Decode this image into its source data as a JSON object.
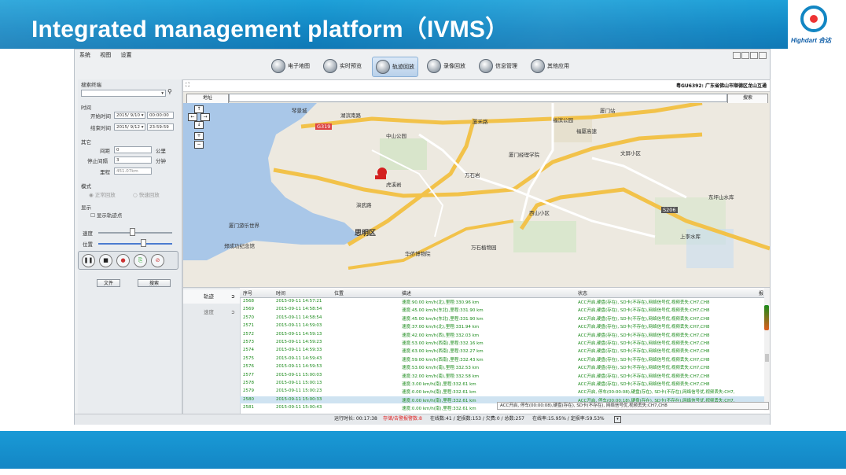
{
  "slide": {
    "title": "Integrated management platform（IVMS）",
    "logo_text": "Highdart 合达"
  },
  "menu": [
    "系统",
    "视图",
    "设置"
  ],
  "toolbar": [
    {
      "label": "电子地图",
      "icon": "map-icon"
    },
    {
      "label": "实时预览",
      "icon": "camera-icon"
    },
    {
      "label": "轨迹回放",
      "icon": "track-icon",
      "active": true
    },
    {
      "label": "录像回放",
      "icon": "video-icon"
    },
    {
      "label": "信息管理",
      "icon": "info-icon"
    },
    {
      "label": "其他应用",
      "icon": "apps-icon"
    }
  ],
  "left": {
    "search_label": "搜索终端",
    "time_label": "时间",
    "start_label": "开始时间",
    "start_date": "2015/ 9/10 ▾",
    "start_time": "00:00:00",
    "end_label": "结束时间",
    "end_date": "2015/ 9/12 ▾",
    "end_time": "23:59:59",
    "other_label": "其它",
    "range_label": "间距",
    "range_value": "0",
    "range_unit": "公里",
    "stop_label": "停止间隔",
    "stop_value": "3",
    "stop_unit": "分钟",
    "mileage_label": "里程",
    "mileage_value": "451.07km",
    "mode_label": "模式",
    "mode_normal": "正常回放",
    "mode_fast": "快速回放",
    "display_label": "显示",
    "show_points": "显示轨迹点",
    "speed_label": "速度",
    "position_label": "位置",
    "file_btn": "文件",
    "search_btn": "搜索"
  },
  "map": {
    "addr_label": "地址",
    "search_btn": "搜索",
    "vehicle_info": "粤GU6392: 广东省佛山市顺德区龙山互通",
    "labels": [
      "琴景城",
      "湖滨南路",
      "厦门站",
      "福滨公园",
      "厦禾路",
      "中山公园",
      "文屏小区",
      "厦门经理学院",
      "万石岩",
      "东坪山水库",
      "思明区",
      "上李水库",
      "厦门游乐世界",
      "郑成功纪念馆",
      "华侨博物院",
      "万石植物园",
      "西山小区",
      "G319",
      "S206",
      "福厦高速",
      "演武路",
      "虎溪岩"
    ]
  },
  "tabs": [
    "轨迹",
    "速度"
  ],
  "table": {
    "headers": [
      "序号",
      "时间",
      "位置",
      "描述",
      "状态",
      "报"
    ],
    "rows": [
      {
        "id": "2568",
        "time": "2015-09-11 14:57:21",
        "desc": "速度:90.00 km/h(北),里程:330.96 km",
        "status": "ACC开启,硬盘(存在), SD卡(不存在),网络信号优,视频丢失:CH7,CH8"
      },
      {
        "id": "2569",
        "time": "2015-09-11 14:58:54",
        "desc": "速度:45.00 km/h(东北),里程:331.90 km",
        "status": "ACC开启,硬盘(存在), SD卡(不存在),网络信号优,视频丢失:CH7,CH8"
      },
      {
        "id": "2570",
        "time": "2015-09-11 14:58:54",
        "desc": "速度:45.00 km/h(东北),里程:331.90 km",
        "status": "ACC开启,硬盘(存在), SD卡(不存在),网络信号优,视频丢失:CH7,CH8"
      },
      {
        "id": "2571",
        "time": "2015-09-11 14:59:03",
        "desc": "速度:37.00 km/h(北),里程:331.94 km",
        "status": "ACC开启,硬盘(存在), SD卡(不存在),网络信号优,视频丢失:CH7,CH8"
      },
      {
        "id": "2572",
        "time": "2015-09-11 14:59:13",
        "desc": "速度:42.00 km/h(西),里程:332.03 km",
        "status": "ACC开启,硬盘(存在), SD卡(不存在),网络信号优,视频丢失:CH7,CH8"
      },
      {
        "id": "2573",
        "time": "2015-09-11 14:59:23",
        "desc": "速度:53.00 km/h(西南),里程:332.16 km",
        "status": "ACC开启,硬盘(存在), SD卡(不存在),网络信号优,视频丢失:CH7,CH8"
      },
      {
        "id": "2574",
        "time": "2015-09-11 14:59:33",
        "desc": "速度:63.00 km/h(西南),里程:332.27 km",
        "status": "ACC开启,硬盘(存在), SD卡(不存在),网络信号优,视频丢失:CH7,CH8"
      },
      {
        "id": "2575",
        "time": "2015-09-11 14:59:43",
        "desc": "速度:59.00 km/h(西南),里程:332.43 km",
        "status": "ACC开启,硬盘(存在), SD卡(不存在),网络信号优,视频丢失:CH7,CH8"
      },
      {
        "id": "2576",
        "time": "2015-09-11 14:59:53",
        "desc": "速度:53.00 km/h(南),里程:332.53 km",
        "status": "ACC开启,硬盘(存在), SD卡(不存在),网络信号优,视频丢失:CH7,CH8"
      },
      {
        "id": "2577",
        "time": "2015-09-11 15:00:03",
        "desc": "速度:32.00 km/h(南),里程:332.58 km",
        "status": "ACC开启,硬盘(存在), SD卡(不存在),网络信号优,视频丢失:CH7,CH8"
      },
      {
        "id": "2578",
        "time": "2015-09-11 15:00:13",
        "desc": "速度:3.00 km/h(南),里程:332.61 km",
        "status": "ACC开启,硬盘(存在), SD卡(不存在),网络信号优,视频丢失:CH7,CH8"
      },
      {
        "id": "2579",
        "time": "2015-09-11 15:00:23",
        "desc": "速度:0.00 km/h(南),里程:332.61 km",
        "status": "ACC开启, 停车(00:00:08),硬盘(存在), SD卡(不存在),网络信号优,视频丢失:CH7,"
      },
      {
        "id": "2580",
        "time": "2015-09-11 15:00:33",
        "desc": "速度:0.00 km/h(南),里程:332.61 km",
        "status": "ACC开启, 停车(00:00:18),硬盘(存在), SD卡(不存在),网络信号优,视频丢失:CH7,"
      },
      {
        "id": "2581",
        "time": "2015-09-11 15:00:43",
        "desc": "速度:0.00 km/h(南),里程:332.61 km",
        "status": ""
      }
    ],
    "selected_index": 12
  },
  "tooltip": "ACC开启, 停车(00:00:08),硬盘(存在), SD卡(不存在), 网络信号优,视频丢失:CH7,CH8",
  "status": {
    "runtime": "运行时长: 00:17:38",
    "alarm": "存储/告警报警数:8",
    "online": "在线数:41 / 定损数:153 / 欠费:0 / 总数:257",
    "rate": "在线率:15.95% / 定损率:59.53%",
    "alarm_color": "#e02020"
  }
}
